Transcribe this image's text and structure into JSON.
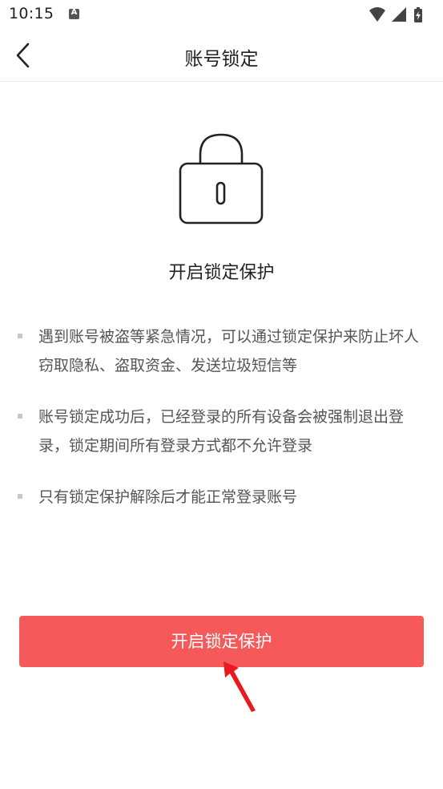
{
  "status_bar": {
    "time": "10:15",
    "notification_glyph": "A",
    "icons": [
      "wifi-icon",
      "signal-icon",
      "battery-charging-icon"
    ]
  },
  "header": {
    "back_icon": "chevron-left-icon",
    "title": "账号锁定"
  },
  "main": {
    "illustration": "lock-icon",
    "heading": "开启锁定保护",
    "info": [
      "遇到账号被盗等紧急情况，可以通过锁定保护来防止坏人窃取隐私、盗取资金、发送垃圾短信等",
      "账号锁定成功后，已经登录的所有设备会被强制退出登录，锁定期间所有登录方式都不允许登录",
      "只有锁定保护解除后才能正常登录账号"
    ],
    "button_label": "开启锁定保护"
  },
  "colors": {
    "accent": "#f6595a",
    "pointer": "#e8191f",
    "text_primary": "#222222",
    "text_secondary": "#555555"
  }
}
